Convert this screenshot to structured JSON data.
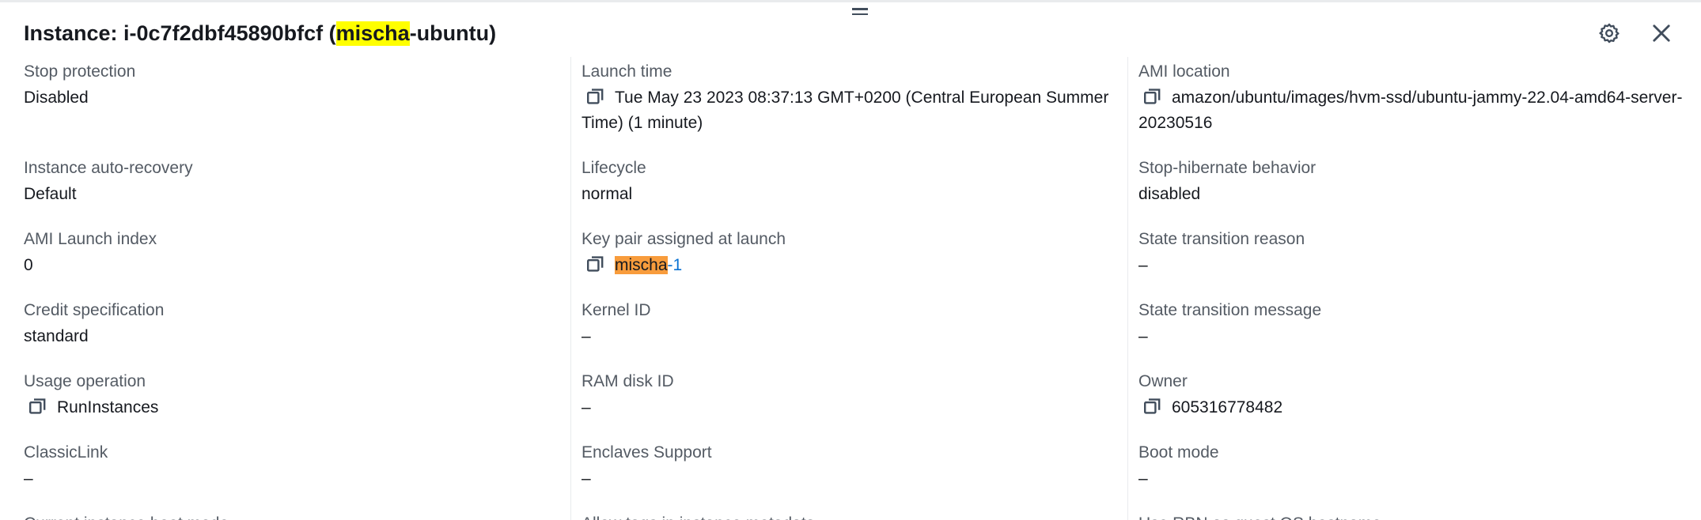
{
  "header": {
    "title_prefix": "Instance: i-0c7f2dbf45890bfcf (",
    "title_highlight": "mischa",
    "title_suffix": "-ubuntu)"
  },
  "icons": {
    "settings": "gear-icon",
    "close": "close-icon",
    "copy": "copy-icon",
    "drag": "drag-handle-icon"
  },
  "colors": {
    "search_highlight": "#ffff00",
    "active_highlight": "#f89c3c",
    "link": "#0972d3",
    "label": "#545b64",
    "text": "#16191f"
  },
  "col1": {
    "stop_protection": {
      "label": "Stop protection",
      "value": "Disabled"
    },
    "auto_recovery": {
      "label": "Instance auto-recovery",
      "value": "Default"
    },
    "ami_launch_index": {
      "label": "AMI Launch index",
      "value": "0"
    },
    "credit_spec": {
      "label": "Credit specification",
      "value": "standard"
    },
    "usage_operation": {
      "label": "Usage operation",
      "value": "RunInstances"
    },
    "classiclink": {
      "label": "ClassicLink",
      "value": "–"
    },
    "next_label": "Current instance boot mode"
  },
  "col2": {
    "launch_time": {
      "label": "Launch time",
      "value": "Tue May 23 2023 08:37:13 GMT+0200 (Central European Summer Time) (1 minute)"
    },
    "lifecycle": {
      "label": "Lifecycle",
      "value": "normal"
    },
    "key_pair": {
      "label": "Key pair assigned at launch",
      "value_highlight": "mischa",
      "value_rest": "-1"
    },
    "kernel_id": {
      "label": "Kernel ID",
      "value": "–"
    },
    "ram_disk_id": {
      "label": "RAM disk ID",
      "value": "–"
    },
    "enclaves": {
      "label": "Enclaves Support",
      "value": "–"
    },
    "next_label": "Allow tags in instance metadata"
  },
  "col3": {
    "ami_location": {
      "label": "AMI location",
      "value": "amazon/ubuntu/images/hvm-ssd/ubuntu-jammy-22.04-amd64-server-20230516"
    },
    "stop_hibernate": {
      "label": "Stop-hibernate behavior",
      "value": "disabled"
    },
    "state_reason": {
      "label": "State transition reason",
      "value": "–"
    },
    "state_message": {
      "label": "State transition message",
      "value": "–"
    },
    "owner": {
      "label": "Owner",
      "value": "605316778482"
    },
    "boot_mode": {
      "label": "Boot mode",
      "value": "–"
    },
    "next_label": "Use RBN as guest OS hostname"
  }
}
